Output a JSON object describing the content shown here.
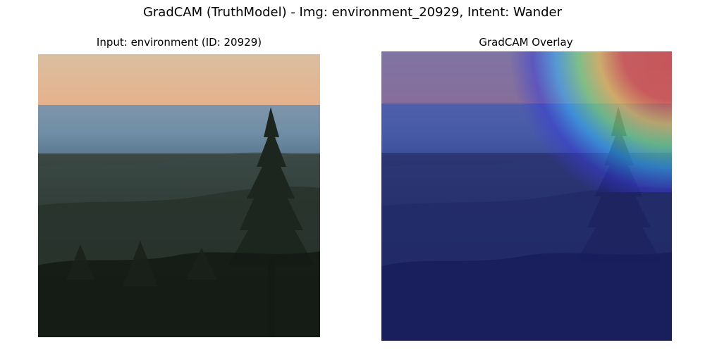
{
  "figure": {
    "suptitle": "GradCAM (TruthModel) - Img: environment_20929, Intent: Wander"
  },
  "panels": [
    {
      "title": "Input: environment (ID: 20929)"
    },
    {
      "title": "GradCAM Overlay"
    }
  ],
  "colors": {
    "overlay_cool": "#1e23aa",
    "overlay_hot": "#ff3b1e"
  }
}
